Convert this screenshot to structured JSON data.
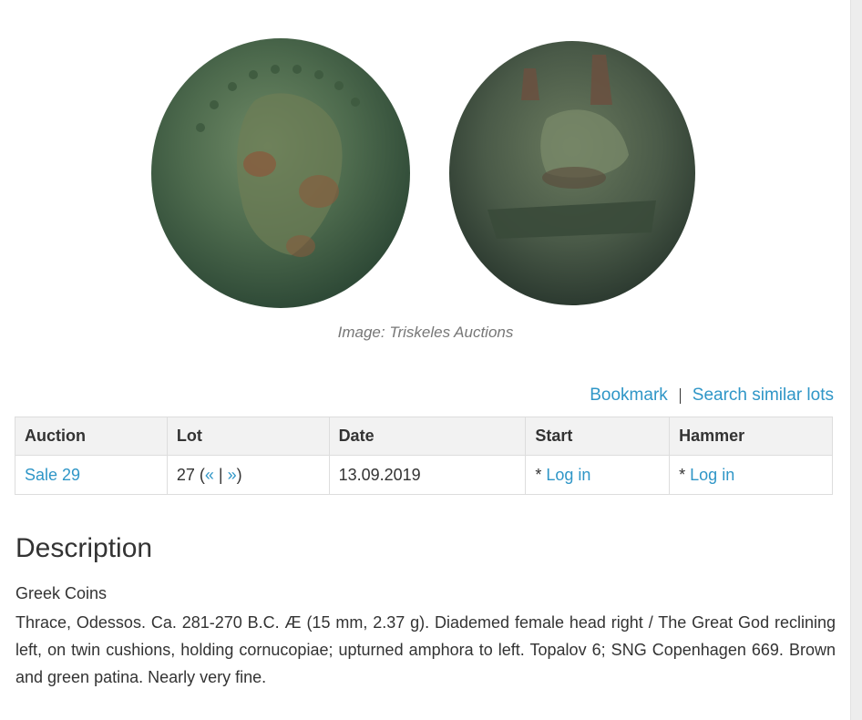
{
  "image": {
    "caption": "Image: Triskeles Auctions"
  },
  "actions": {
    "bookmark": "Bookmark",
    "search_similar": "Search similar lots"
  },
  "table": {
    "headers": [
      "Auction",
      "Lot",
      "Date",
      "Start",
      "Hammer"
    ],
    "row": {
      "auction": "Sale 29",
      "lot_number": "27",
      "prev": "«",
      "next": "»",
      "date": "13.09.2019",
      "start_prefix": "* ",
      "start_link": "Log in",
      "hammer_prefix": "* ",
      "hammer_link": "Log in"
    }
  },
  "description": {
    "title": "Description",
    "category": "Greek Coins",
    "text": "Thrace, Odessos. Ca. 281-270 B.C. Æ (15 mm, 2.37 g). Diademed female head right / The Great God reclining left, on twin cushions, holding cornucopiae; upturned amphora to left. Topalov 6; SNG Copen­hagen 669. Brown and green patina. Nearly very fine."
  },
  "colors": {
    "link": "#2f96c7",
    "header_bg": "#f2f2f2",
    "coin_green": "#4f6b4f"
  }
}
